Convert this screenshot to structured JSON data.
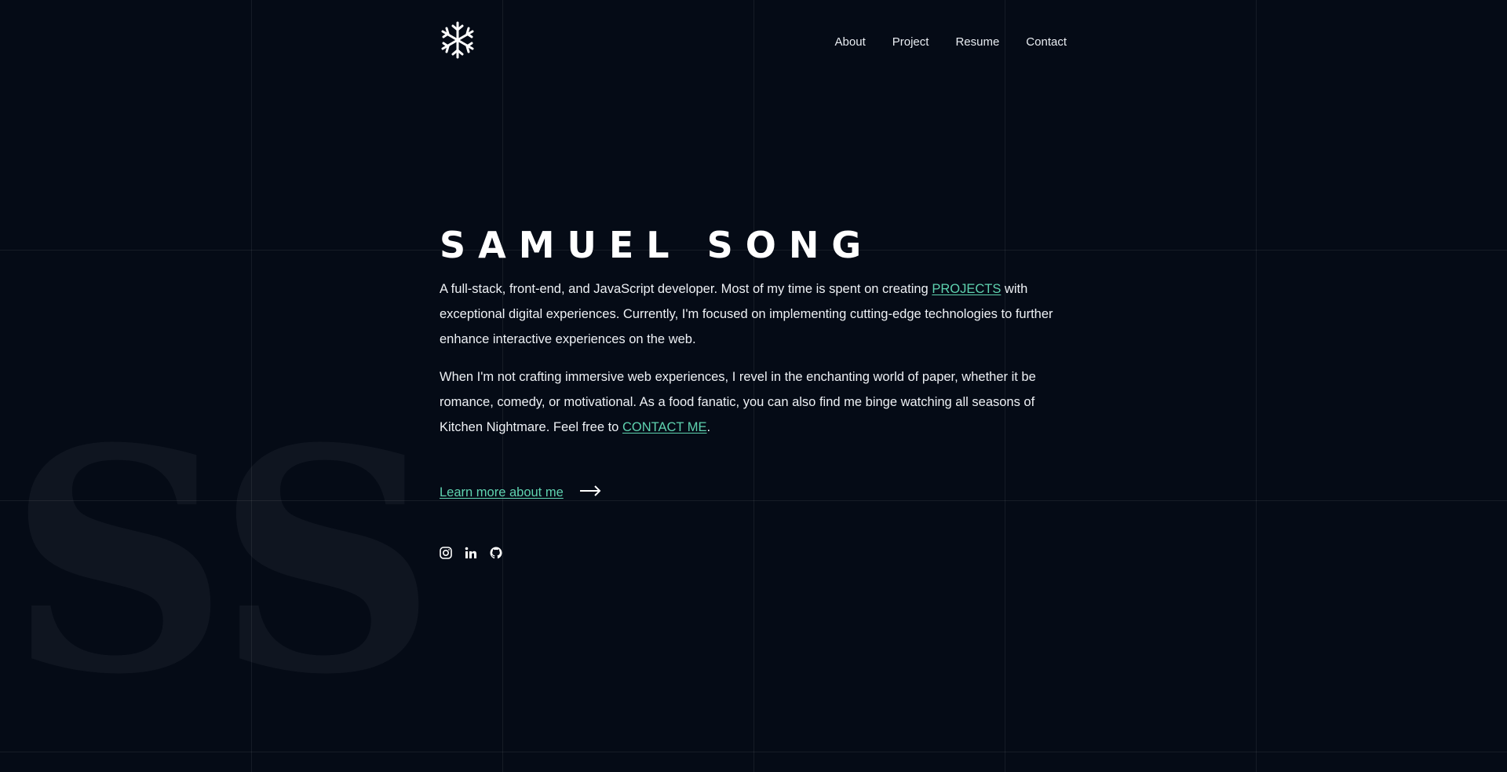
{
  "nav": {
    "items": [
      {
        "label": "About"
      },
      {
        "label": "Project"
      },
      {
        "label": "Resume"
      },
      {
        "label": "Contact"
      }
    ]
  },
  "logo": {
    "icon": "snowflake-icon"
  },
  "hero": {
    "name": "SAMUEL SONG",
    "intro_before": "A full-stack, front-end, and JavaScript developer. Most of my time is spent on creating ",
    "intro_link": "PROJECTS",
    "intro_after": " with exceptional digital experiences. Currently, I'm focused on implementing cutting-edge technologies to further enhance interactive experiences on the web.",
    "hobby_before": "When I'm not crafting immersive web experiences, I revel in the enchanting world of paper, whether it be romance, comedy, or motivational. As a food fanatic, you can also find me binge watching all seasons of Kitchen Nightmare. Feel free to ",
    "hobby_link": "CONTACT ME",
    "hobby_after": ".",
    "learn_more": "Learn more about me"
  },
  "background": {
    "monogram": "SS"
  },
  "socials": [
    "instagram-icon",
    "linkedin-icon",
    "github-icon"
  ],
  "colors": {
    "background": "#050b16",
    "accent": "#5fd3b0",
    "text": "#eef1f5"
  }
}
